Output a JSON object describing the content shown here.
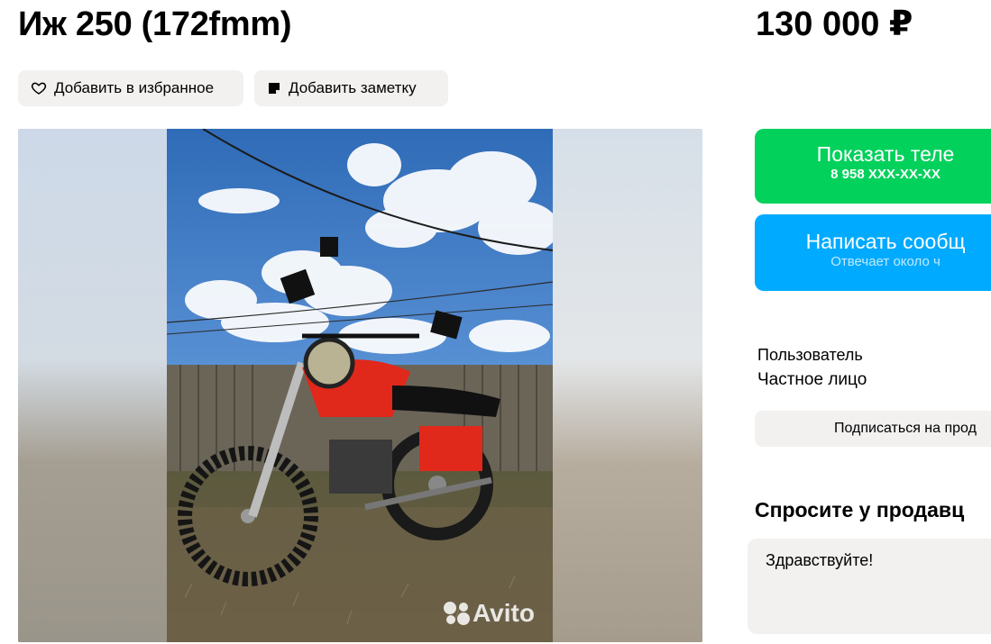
{
  "listing": {
    "title": "Иж 250 (172fmm)",
    "price": "130 000 ₽"
  },
  "actions": {
    "favorite_label": "Добавить в избранное",
    "note_label": "Добавить заметку"
  },
  "gallery": {
    "watermark": "Avito"
  },
  "contact": {
    "phone_label": "Показать теле",
    "phone_masked": "8 958 XXX-XX-XX",
    "message_label": "Написать сообщ",
    "message_sub": "Отвечает около ч"
  },
  "seller": {
    "role": "Пользователь",
    "type": "Частное лицо",
    "subscribe_label": "Подписаться на прод"
  },
  "ask": {
    "heading": "Спросите у продавц",
    "message_value": "Здравствуйте!"
  },
  "colors": {
    "phone_button": "#02d15c",
    "message_button": "#00aaff",
    "neutral_button": "#f2f1f0"
  }
}
